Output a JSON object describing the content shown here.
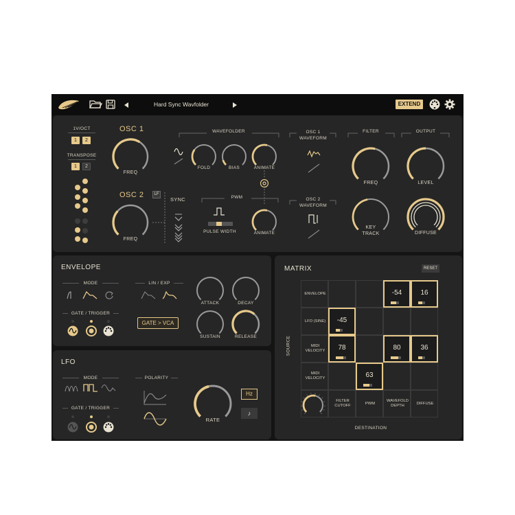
{
  "header": {
    "preset_name": "Hard Sync Wavfolder",
    "extend_label": "EXTEND",
    "icons": [
      "shell-logo-icon",
      "folder-icon",
      "save-icon",
      "prev-arrow-icon",
      "next-arrow-icon",
      "midi-icon",
      "gear-icon"
    ]
  },
  "osc": {
    "octave_label": "1V/OCT",
    "transpose_label": "TRANSPOSE",
    "chip_1": "1",
    "chip_2": "2",
    "osc1_title": "OSC 1",
    "osc2_title": "OSC 2",
    "lf_label": "LF",
    "freq_label": "FREQ",
    "sync_label": "SYNC",
    "wavefolder_label": "WAVEFOLDER",
    "fold_label": "FOLD",
    "bias_label": "BIAS",
    "animate_label": "ANIMATE",
    "pwm_label": "PWM",
    "pulse_width_label": "PULSE WIDTH",
    "osc1_waveform_label": "OSC 1 WAVEFORM",
    "osc2_waveform_label": "OSC 2 WAVEFORM",
    "filter_label": "FILTER",
    "output_label": "OUTPUT",
    "filter_freq_label": "FREQ",
    "key_track_label": "KEY TRACK",
    "level_label": "LEVEL",
    "diffuse_label": "DIFFUSE"
  },
  "envelope": {
    "title": "ENVELOPE",
    "mode_label": "MODE",
    "lin_exp_label": "LIN / EXP",
    "gate_trigger_label": "GATE / TRIGGER",
    "gate_vca_label": "GATE > VCA",
    "attack_label": "ATTACK",
    "decay_label": "DECAY",
    "sustain_label": "SUSTAIN",
    "release_label": "RELEASE"
  },
  "lfo": {
    "title": "LFO",
    "mode_label": "MODE",
    "polarity_label": "POLARITY",
    "gate_trigger_label": "GATE / TRIGGER",
    "rate_label": "RATE",
    "hz_label": "Hz",
    "note_label": "♪"
  },
  "matrix": {
    "title": "MATRIX",
    "reset_label": "RESET",
    "source_axis": "SOURCE",
    "destination_axis": "DESTINATION",
    "sources": [
      "ENVELOPE",
      "LFO (SINE)",
      "MIDI VELOCITY",
      "MIDI VELOCITY"
    ],
    "destinations": [
      "FILTER CUTOFF",
      "PWM",
      "WAVEFOLD DEPTH",
      "DIFFUSE"
    ],
    "cells": [
      {
        "row": 0,
        "col": 2,
        "value": "-54",
        "amount": -0.54
      },
      {
        "row": 0,
        "col": 3,
        "value": "16",
        "amount": 0.16
      },
      {
        "row": 1,
        "col": 0,
        "value": "-45",
        "amount": -0.45
      },
      {
        "row": 2,
        "col": 0,
        "value": "78",
        "amount": 0.78
      },
      {
        "row": 2,
        "col": 2,
        "value": "80",
        "amount": 0.8
      },
      {
        "row": 2,
        "col": 3,
        "value": "36",
        "amount": 0.36
      },
      {
        "row": 3,
        "col": 1,
        "value": "63",
        "amount": 0.63
      }
    ]
  },
  "colors": {
    "accent": "#e6c98b",
    "background": "#141414",
    "panel": "#262626"
  }
}
